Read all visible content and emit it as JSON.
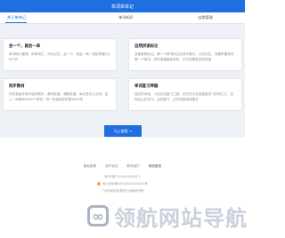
{
  "header": {
    "title": "单词单单记"
  },
  "tabs": [
    {
      "label": "关于单单记"
    },
    {
      "label": "单词知识"
    },
    {
      "label": "自我管理"
    }
  ],
  "cards": [
    {
      "title": "会一个，就会一串",
      "text": "单词碎片管理，同单词汇，对比记忆，会一个，就会一串！轻松掌握3万8千词"
    },
    {
      "title": "自然拼读标注",
      "text": "全面音频标注，第一个单词标注自然不能分，分析记忆，流通掌握单词第一个单词，同时调值模拟到掌，记忆效果更加的快速"
    },
    {
      "title": "同步教材",
      "text": "同步各版本各年级的教材，教材依据，课程发展，每天多花几分钟，加入一年期到3600个单词，同一年级轻松掌握3600词"
    },
    {
      "title": "单词复习神器",
      "text": "遗忘时间表，人性化的复习工具，记忆可以变成更高学习的词汇汇，实现自主化学习，及时复习，记忆效果成倍提升"
    }
  ],
  "cta": {
    "label": "马上使用 →"
  },
  "footer": {
    "links": [
      "隐私政策",
      "用户协议",
      "联系我们",
      "网页首页"
    ],
    "line1": "粤ICP备2021000000号-1",
    "line2": "粤公网安备44030502000000号",
    "line3": "广州市某科技有限公司版权所有"
  },
  "watermark": {
    "text": "领航网站导航"
  }
}
